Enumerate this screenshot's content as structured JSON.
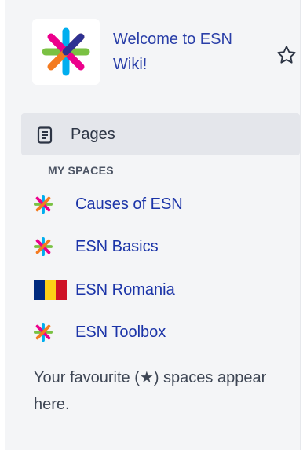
{
  "space": {
    "title": "Welcome to ESN Wiki!",
    "logo_icon": "esn-star-logo",
    "star_icon": "star-outline-icon"
  },
  "nav": {
    "pages_label": "Pages",
    "pages_icon": "document-icon"
  },
  "my_spaces": {
    "heading": "MY SPACES",
    "items": [
      {
        "label": "Causes of ESN",
        "icon": "esn-star-logo"
      },
      {
        "label": "ESN Basics",
        "icon": "esn-star-logo"
      },
      {
        "label": "ESN Romania",
        "icon": "romania-flag-icon"
      },
      {
        "label": "ESN Toolbox",
        "icon": "esn-star-logo"
      }
    ]
  },
  "hint": "Your favourite (★) spaces appear here.",
  "colors": {
    "sidebar_bg": "#f4f5f7",
    "link": "#1b34a8",
    "selected_bg": "#e4e6eb",
    "esn_cyan": "#00aeef",
    "esn_magenta": "#ec008c",
    "esn_green": "#7ac143",
    "esn_orange": "#f47b20",
    "esn_blue": "#2e3192"
  }
}
